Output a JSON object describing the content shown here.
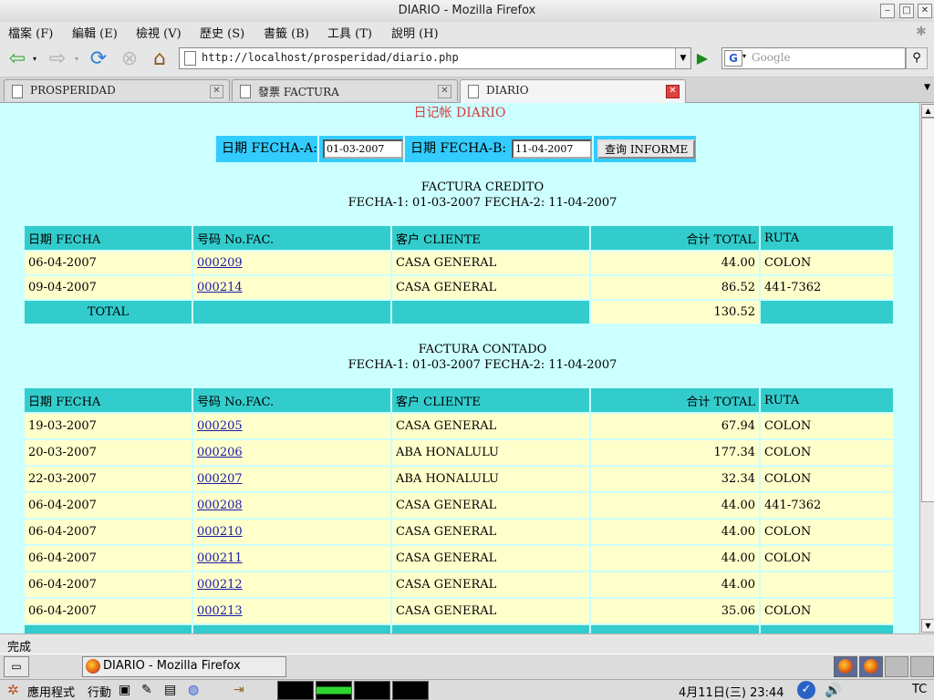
{
  "window": {
    "title": "DIARIO - Mozilla Firefox"
  },
  "menu": [
    "檔案 (F)",
    "編輯 (E)",
    "檢視 (V)",
    "歷史 (S)",
    "書籤 (B)",
    "工具 (T)",
    "說明 (H)"
  ],
  "nav": {
    "url": "http://localhost/prosperidad/diario.php",
    "search_placeholder": "Google"
  },
  "tabs": [
    {
      "label": "PROSPERIDAD",
      "active": false
    },
    {
      "label": "發票 FACTURA",
      "active": false
    },
    {
      "label": "DIARIO",
      "active": true
    }
  ],
  "page": {
    "heading": "日记帐 DIARIO",
    "form": {
      "label_a": "日期 FECHA-A:",
      "value_a": "01-03-2007",
      "label_b": "日期 FECHA-B:",
      "value_b": "11-04-2007",
      "button": "查询 INFORME"
    },
    "columns": [
      "日期 FECHA",
      "号码 No.FAC.",
      "客户 CLIENTE",
      "合计 TOTAL",
      "RUTA"
    ],
    "credito": {
      "title": "FACTURA CREDITO",
      "subtitle": "FECHA-1: 01-03-2007 FECHA-2: 11-04-2007",
      "rows": [
        {
          "fecha": "06-04-2007",
          "fac": "000209",
          "cliente": "CASA GENERAL",
          "total": "44.00",
          "ruta": "COLON"
        },
        {
          "fecha": "09-04-2007",
          "fac": "000214",
          "cliente": "CASA GENERAL",
          "total": "86.52",
          "ruta": "441-7362"
        }
      ],
      "total_label": "TOTAL",
      "total_value": "130.52"
    },
    "contado": {
      "title": "FACTURA CONTADO",
      "subtitle": "FECHA-1: 01-03-2007 FECHA-2: 11-04-2007",
      "rows": [
        {
          "fecha": "19-03-2007",
          "fac": "000205",
          "cliente": "CASA GENERAL",
          "total": "67.94",
          "ruta": "COLON"
        },
        {
          "fecha": "20-03-2007",
          "fac": "000206",
          "cliente": "ABA HONALULU",
          "total": "177.34",
          "ruta": "COLON"
        },
        {
          "fecha": "22-03-2007",
          "fac": "000207",
          "cliente": "ABA HONALULU",
          "total": "32.34",
          "ruta": "COLON"
        },
        {
          "fecha": "06-04-2007",
          "fac": "000208",
          "cliente": "CASA GENERAL",
          "total": "44.00",
          "ruta": "441-7362"
        },
        {
          "fecha": "06-04-2007",
          "fac": "000210",
          "cliente": "CASA GENERAL",
          "total": "44.00",
          "ruta": "COLON"
        },
        {
          "fecha": "06-04-2007",
          "fac": "000211",
          "cliente": "CASA GENERAL",
          "total": "44.00",
          "ruta": "COLON"
        },
        {
          "fecha": "06-04-2007",
          "fac": "000212",
          "cliente": "CASA GENERAL",
          "total": "44.00",
          "ruta": ""
        },
        {
          "fecha": "06-04-2007",
          "fac": "000213",
          "cliente": "CASA GENERAL",
          "total": "35.06",
          "ruta": "COLON"
        }
      ]
    }
  },
  "status": {
    "text": "完成"
  },
  "taskbar": {
    "task_label": "DIARIO - Mozilla Firefox"
  },
  "panel": {
    "apps": "應用程式",
    "actions": "行動",
    "clock": "4月11日(三) 23:44",
    "ime": "TC"
  }
}
